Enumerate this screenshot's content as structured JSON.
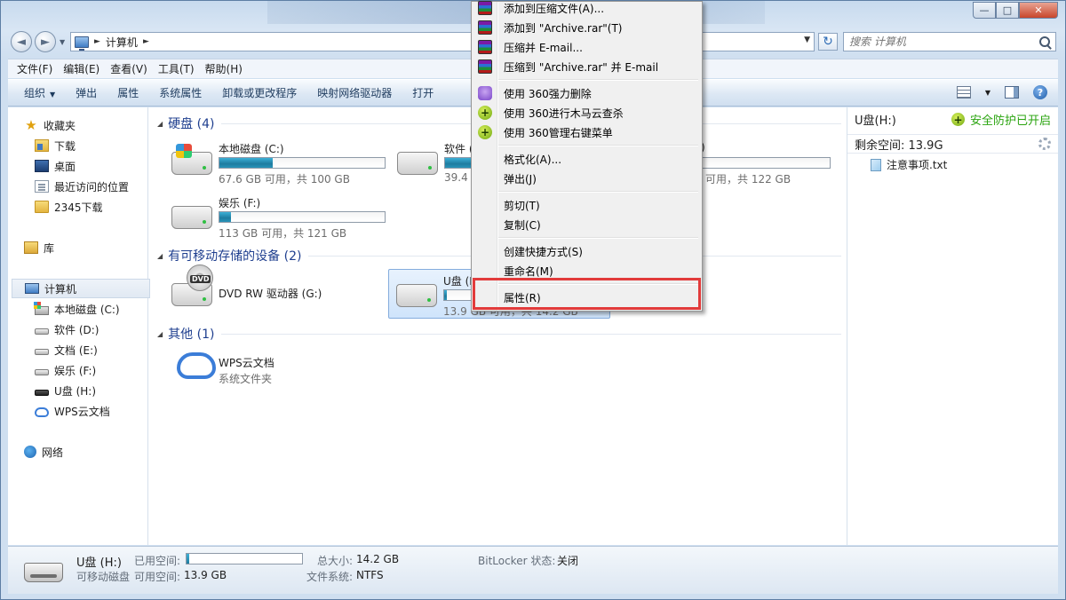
{
  "window": {
    "controls": [
      "—",
      "□",
      "✕"
    ],
    "nav_back": "◄",
    "nav_forward": "►"
  },
  "address": {
    "crumbs": [
      "计算机"
    ],
    "separator": "►",
    "dropdown": "▼",
    "refresh": "↻"
  },
  "search": {
    "placeholder": "搜索 计算机"
  },
  "menubar": [
    "文件(F)",
    "编辑(E)",
    "查看(V)",
    "工具(T)",
    "帮助(H)"
  ],
  "commandbar": {
    "items": [
      "组织",
      "弹出",
      "属性",
      "系统属性",
      "卸载或更改程序",
      "映射网络驱动器",
      "打开"
    ],
    "organize_dropdown": "▼",
    "help": "?"
  },
  "navpane": {
    "favorites": {
      "label": "收藏夹",
      "items": [
        "下载",
        "桌面",
        "最近访问的位置",
        "2345下载"
      ]
    },
    "libraries": {
      "label": "库"
    },
    "computer": {
      "label": "计算机",
      "items": [
        "本地磁盘 (C:)",
        "软件 (D:)",
        "文档 (E:)",
        "娱乐 (F:)",
        "U盘 (H:)",
        "WPS云文档"
      ]
    },
    "network": {
      "label": "网络"
    }
  },
  "content": {
    "groups": {
      "hard_disks": "硬盘 (4)",
      "removable": "有可移动存储的设备 (2)",
      "other": "其他 (1)"
    },
    "collapse_glyph": "◢",
    "drives": {
      "c": {
        "name": "本地磁盘 (C:)",
        "info": "67.6 GB 可用，共 100 GB",
        "used_fraction": 0.32
      },
      "d": {
        "name": "软件 (D",
        "info": "39.4 G"
      },
      "e": {
        "name": ")",
        "info": "可用，共 122 GB"
      },
      "f": {
        "name": "娱乐 (F:)",
        "info": "113 GB 可用，共 121 GB",
        "used_fraction": 0.07
      },
      "g": {
        "name": "DVD RW 驱动器 (G:)",
        "badge": "DVD"
      },
      "h": {
        "name": "U盘 (H",
        "info": "13.9 GB 可用，共 14.2 GB"
      },
      "wps": {
        "name": "WPS云文档",
        "info": "系统文件夹"
      }
    }
  },
  "details": {
    "drive": "U盘(H:)",
    "security": "安全防护已开启",
    "security_glyph": "+",
    "free_space": "剩余空间: 13.9G",
    "file": "注意事项.txt",
    "expand": "›"
  },
  "statusbar": {
    "name": "U盘 (H:)",
    "type": "可移动磁盘",
    "used_label": "已用空间:",
    "used_fraction": 0.02,
    "free_label": "可用空间:",
    "free_value": "13.9 GB",
    "total_label": "总大小:",
    "total_value": "14.2 GB",
    "fs_label": "文件系统:",
    "fs_value": "NTFS",
    "bitlocker_label": "BitLocker 状态:",
    "bitlocker_value": "关闭"
  },
  "context_menu": {
    "items": [
      {
        "label": "添加到压缩文件(A)...",
        "icon": "winrar-icon"
      },
      {
        "label": "添加到 \"Archive.rar\"(T)",
        "icon": "winrar-icon"
      },
      {
        "label": "压缩并 E-mail...",
        "icon": "winrar-icon"
      },
      {
        "label": "压缩到 \"Archive.rar\" 并 E-mail",
        "icon": "winrar-icon"
      },
      {
        "label": "使用 360强力删除",
        "icon": "360-delete-icon"
      },
      {
        "label": "使用 360进行木马云查杀",
        "icon": "360-shield-icon"
      },
      {
        "label": "使用 360管理右键菜单",
        "icon": "360-shield-icon"
      },
      {
        "label": "格式化(A)...",
        "icon": ""
      },
      {
        "label": "弹出(J)",
        "icon": ""
      },
      {
        "label": "剪切(T)",
        "icon": ""
      },
      {
        "label": "复制(C)",
        "icon": ""
      },
      {
        "label": "创建快捷方式(S)",
        "icon": ""
      },
      {
        "label": "重命名(M)",
        "icon": ""
      },
      {
        "label": "属性(R)",
        "icon": ""
      }
    ],
    "highlight_color": "#e23b3b"
  }
}
